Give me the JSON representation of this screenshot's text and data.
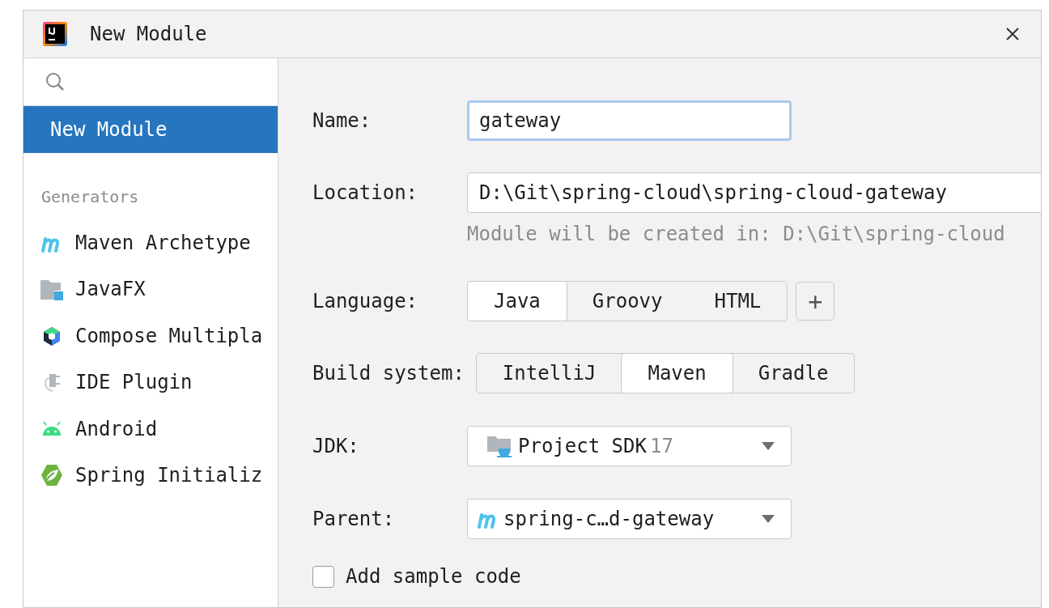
{
  "window": {
    "title": "New Module"
  },
  "sidebar": {
    "items": [
      {
        "label": "New Module",
        "selected": true
      }
    ],
    "section_header": "Generators",
    "generators": [
      {
        "label": "Maven Archetype",
        "kind": "maven",
        "selected": false
      },
      {
        "label": "JavaFX",
        "kind": "javafx",
        "selected": false
      },
      {
        "label": "Compose Multipla",
        "kind": "compose",
        "selected": false
      },
      {
        "label": "IDE Plugin",
        "kind": "plugin",
        "selected": false
      },
      {
        "label": "Android",
        "kind": "android",
        "selected": false
      },
      {
        "label": "Spring Initializ",
        "kind": "spring",
        "selected": false
      }
    ]
  },
  "form": {
    "name": {
      "label": "Name:",
      "value": "gateway"
    },
    "location": {
      "label": "Location:",
      "value": "D:\\Git\\spring-cloud\\spring-cloud-gateway",
      "hint": "Module will be created in: D:\\Git\\spring-cloud"
    },
    "language": {
      "label": "Language:",
      "options": [
        {
          "label": "Java",
          "selected": true
        },
        {
          "label": "Groovy",
          "selected": false
        },
        {
          "label": "HTML",
          "selected": false
        }
      ],
      "add_button": "+"
    },
    "build_system": {
      "label": "Build system:",
      "options": [
        {
          "label": "IntelliJ",
          "selected": false
        },
        {
          "label": "Maven",
          "selected": true
        },
        {
          "label": "Gradle",
          "selected": false
        }
      ]
    },
    "jdk": {
      "label": "JDK:",
      "value": "Project SDK",
      "version": "17"
    },
    "parent": {
      "label": "Parent:",
      "value": "spring-c…d-gateway"
    },
    "sample_code": {
      "label": "Add sample code",
      "checked": false
    }
  }
}
